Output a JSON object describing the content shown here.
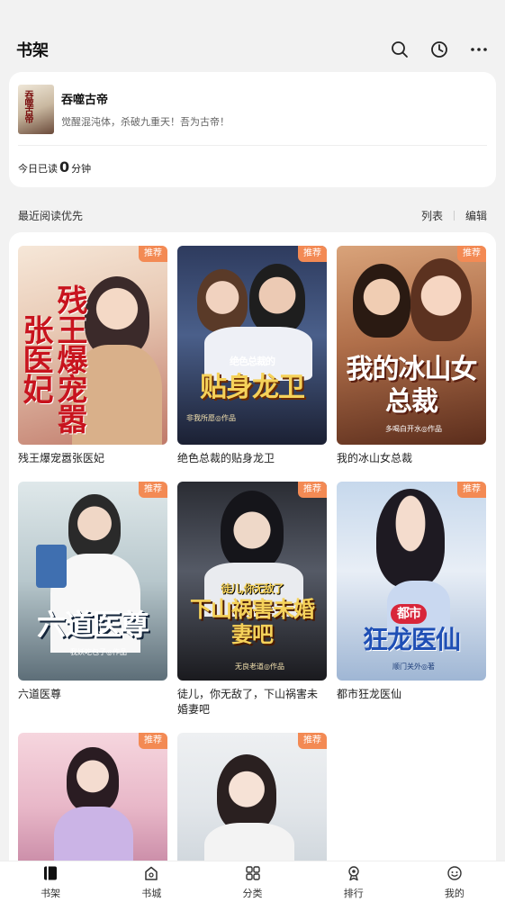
{
  "header": {
    "title": "书架"
  },
  "current": {
    "cover_text": "吞噬古帝",
    "title": "吞噬古帝",
    "desc": "觉醒混沌体，杀破九重天！吾为古帝！",
    "today_prefix": "今日已读",
    "today_minutes": "0",
    "today_suffix": "分钟"
  },
  "section": {
    "title": "最近阅读优先",
    "list_label": "列表",
    "edit_label": "编辑"
  },
  "books": [
    {
      "title": "残王爆宠嚣张医妃",
      "tag": "推荐",
      "cover_title": "残王爆宠嚣张医妃",
      "cover_author": ""
    },
    {
      "title": "绝色总裁的贴身龙卫",
      "tag": "推荐",
      "cover_title": "贴身龙卫",
      "cover_subtitle": "绝色总裁的",
      "cover_author": "非我所愿◎作品"
    },
    {
      "title": "我的冰山女总裁",
      "tag": "推荐",
      "cover_title": "我的冰山女总裁",
      "cover_author": "多喝白开水◎作品"
    },
    {
      "title": "六道医尊",
      "tag": "推荐",
      "cover_title": "六道医尊",
      "cover_author": "我妖吃包子◎作品"
    },
    {
      "title": "徒儿，你无敌了，下山祸害未婚妻吧",
      "tag": "推荐",
      "cover_title": "下山祸害未婚妻吧",
      "cover_subtitle": "徒儿,你无敌了",
      "cover_author": "无良老道◎作品"
    },
    {
      "title": "都市狂龙医仙",
      "tag": "推荐",
      "cover_title": "狂龙医仙",
      "cover_subtitle": "都市",
      "cover_author": "顺门关外◎著"
    },
    {
      "title": "",
      "tag": "推荐",
      "cover_title": "",
      "cover_author": ""
    },
    {
      "title": "",
      "tag": "推荐",
      "cover_title": "",
      "cover_author": ""
    }
  ],
  "nav": [
    {
      "label": "书架",
      "icon": "bookshelf-icon",
      "active": true
    },
    {
      "label": "书城",
      "icon": "bookstore-icon",
      "active": false
    },
    {
      "label": "分类",
      "icon": "category-icon",
      "active": false
    },
    {
      "label": "排行",
      "icon": "ranking-icon",
      "active": false
    },
    {
      "label": "我的",
      "icon": "profile-icon",
      "active": false
    }
  ],
  "colors": {
    "tag_bg": "#f38a54",
    "background": "#f2f2f2",
    "card": "#ffffff"
  }
}
